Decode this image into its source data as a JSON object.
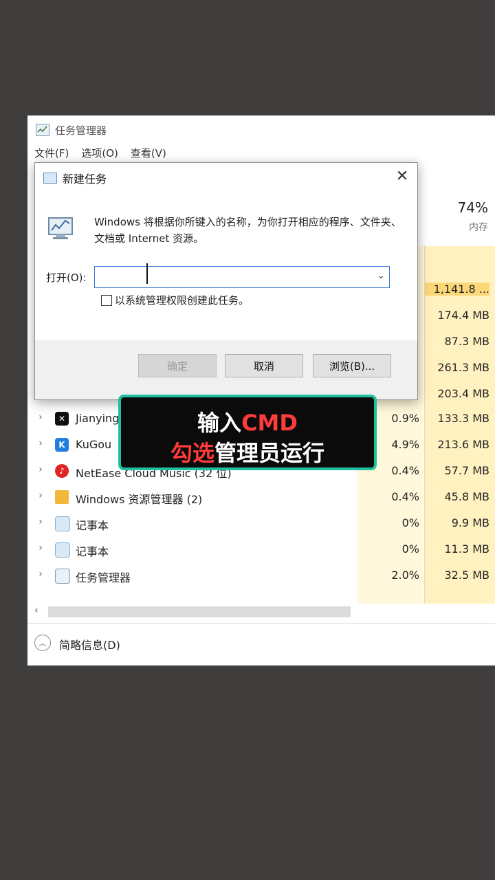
{
  "task_manager": {
    "title": "任务管理器",
    "menu": [
      "文件(F)",
      "选项(O)",
      "查看(V)"
    ],
    "memory_percent": "74%",
    "memory_label": "内存",
    "rows": [
      {
        "name": "Jianying",
        "cpu": "0.9%",
        "mem": "133.3 MB",
        "icon": "jianying-icon",
        "icon_color": "#111111"
      },
      {
        "name": "KuGou",
        "cpu": "4.9%",
        "mem": "213.6 MB",
        "icon": "kugou-icon",
        "icon_color": "#1f7ee0"
      },
      {
        "name": "NetEase Cloud Music (32 位)",
        "cpu": "0.4%",
        "mem": "57.7 MB",
        "icon": "netease-music-icon",
        "icon_color": "#e02424"
      },
      {
        "name": "Windows 资源管理器 (2)",
        "cpu": "0.4%",
        "mem": "45.8 MB",
        "icon": "folder-icon",
        "icon_color": "#f2b83a"
      },
      {
        "name": "记事本",
        "cpu": "0%",
        "mem": "9.9 MB",
        "icon": "notepad-icon",
        "icon_color": "#7fb2d8"
      },
      {
        "name": "记事本",
        "cpu": "0%",
        "mem": "11.3 MB",
        "icon": "notepad-icon",
        "icon_color": "#7fb2d8"
      },
      {
        "name": "任务管理器",
        "cpu": "2.0%",
        "mem": "32.5 MB",
        "icon": "task-manager-icon",
        "icon_color": "#6aa84f"
      }
    ],
    "partial_mem": [
      "1,141.8 ...",
      "174.4 MB",
      "87.3 MB",
      "261.3 MB",
      "203.4 MB"
    ],
    "footer_label": "简略信息(D)"
  },
  "run_dialog": {
    "title": "新建任务",
    "description": "Windows 将根据你所键入的名称，为你打开相应的程序、文件夹、文档或 Internet 资源。",
    "open_label": "打开(O):",
    "input_value": "",
    "checkbox_label": "以系统管理权限创建此任务。",
    "ok_label": "确定",
    "cancel_label": "取消",
    "browse_label": "浏览(B)..."
  },
  "caption": {
    "line1_a": "输入",
    "line1_b": "CMD",
    "line2_a": "勾选",
    "line2_b": "管理员运行"
  },
  "colors": {
    "caption_border": "#1ec0a0",
    "caption_highlight": "#ff3b3b",
    "mem_highlight": "#fcd778"
  }
}
